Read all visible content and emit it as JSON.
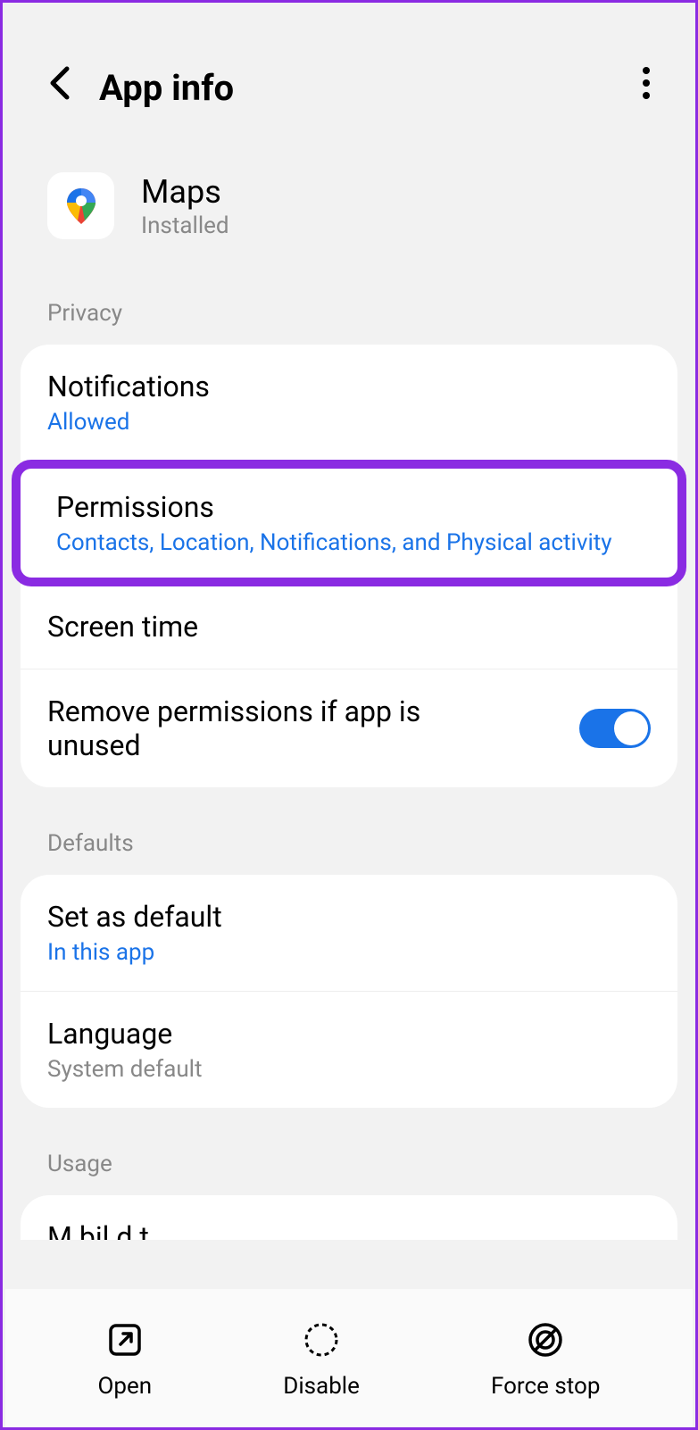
{
  "header": {
    "title": "App info"
  },
  "app": {
    "name": "Maps",
    "status": "Installed"
  },
  "sections": {
    "privacy": {
      "header": "Privacy",
      "notifications": {
        "title": "Notifications",
        "subtitle": "Allowed"
      },
      "permissions": {
        "title": "Permissions",
        "subtitle": "Contacts, Location, Notifications, and Physical activity"
      },
      "screenTime": {
        "title": "Screen time"
      },
      "removePermissions": {
        "title": "Remove permissions if app is unused",
        "enabled": true
      }
    },
    "defaults": {
      "header": "Defaults",
      "setDefault": {
        "title": "Set as default",
        "subtitle": "In this app"
      },
      "language": {
        "title": "Language",
        "subtitle": "System default"
      }
    },
    "usage": {
      "header": "Usage",
      "mobileData": "Mobile data"
    }
  },
  "bottomNav": {
    "open": "Open",
    "disable": "Disable",
    "forceStop": "Force stop"
  }
}
